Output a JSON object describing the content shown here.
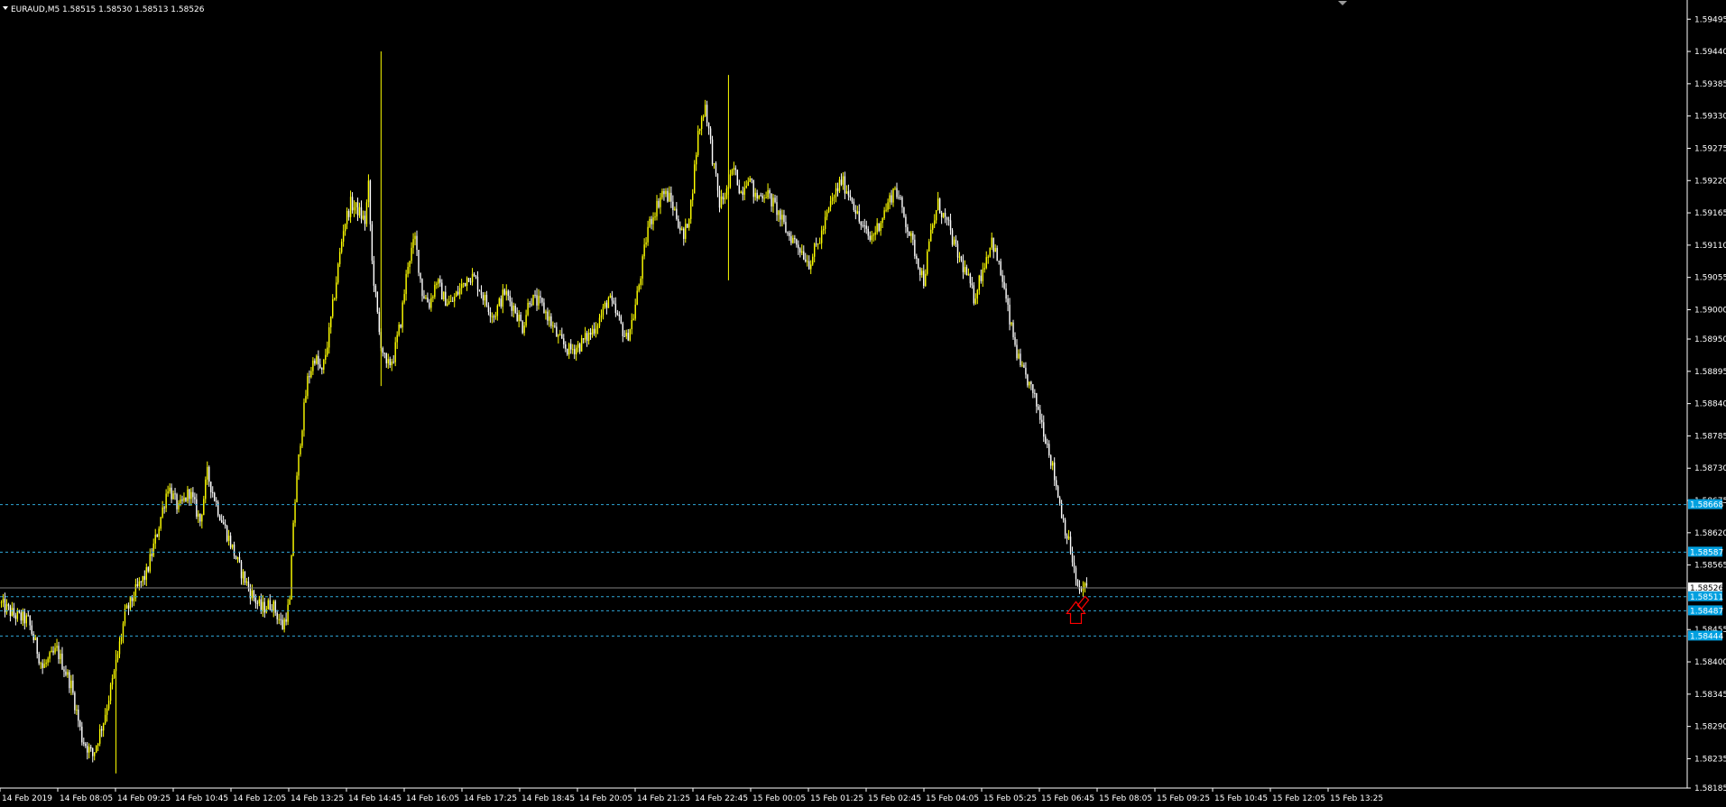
{
  "header": {
    "symbol_timeframe": "EURAUD,M5",
    "ohlc_text": "1.58515 1.58530 1.58513 1.58526"
  },
  "colors": {
    "background": "#000000",
    "bull": "#ffff00",
    "bear": "#ffffff",
    "axis": "#ffffff",
    "level_line": "#2fa7d8",
    "level_label_bg": "#00a0e0",
    "current_line": "#808080",
    "arrow": "#ff0000"
  },
  "chart_data": {
    "type": "candlestick",
    "title": "EURAUD,M5",
    "ylim": [
      1.58185,
      1.595
    ],
    "y_ticks": [
      1.59495,
      1.5944,
      1.59385,
      1.5933,
      1.59275,
      1.5922,
      1.59165,
      1.5911,
      1.59055,
      1.59,
      1.5895,
      1.58895,
      1.5884,
      1.58785,
      1.5873,
      1.58675,
      1.5862,
      1.58565,
      1.58455,
      1.584,
      1.58345,
      1.5829,
      1.58235,
      1.58185
    ],
    "y_tick_labels": [
      "1.59495",
      "1.59440",
      "1.59385",
      "1.59330",
      "1.59275",
      "1.59220",
      "1.59165",
      "1.59110",
      "1.59055",
      "1.59000",
      "1.58950",
      "1.58895",
      "1.58840",
      "1.58785",
      "1.58730",
      "1.58675",
      "1.58620",
      "1.58565",
      "1.58455",
      "1.58400",
      "1.58345",
      "1.58290",
      "1.58235",
      "1.58185"
    ],
    "time_labels": [
      "14 Feb 2019",
      "14 Feb 08:05",
      "14 Feb 09:25",
      "14 Feb 10:45",
      "14 Feb 12:05",
      "14 Feb 13:25",
      "14 Feb 14:45",
      "14 Feb 16:05",
      "14 Feb 17:25",
      "14 Feb 18:45",
      "14 Feb 20:05",
      "14 Feb 21:25",
      "14 Feb 22:45",
      "15 Feb 00:05",
      "15 Feb 01:25",
      "15 Feb 02:45",
      "15 Feb 04:05",
      "15 Feb 05:25",
      "15 Feb 06:45",
      "15 Feb 08:05",
      "15 Feb 09:25",
      "15 Feb 10:45",
      "15 Feb 12:05",
      "15 Feb 13:25"
    ],
    "price_path": [
      [
        0,
        1.585
      ],
      [
        8,
        1.5848
      ],
      [
        16,
        1.5847
      ],
      [
        24,
        1.5839
      ],
      [
        32,
        1.5842
      ],
      [
        40,
        1.5836
      ],
      [
        46,
        1.5827
      ],
      [
        52,
        1.5824
      ],
      [
        58,
        1.583
      ],
      [
        64,
        1.5838
      ],
      [
        70,
        1.5848
      ],
      [
        76,
        1.5852
      ],
      [
        82,
        1.5855
      ],
      [
        88,
        1.5862
      ],
      [
        94,
        1.587
      ],
      [
        100,
        1.5866
      ],
      [
        106,
        1.5869
      ],
      [
        112,
        1.5864
      ],
      [
        116,
        1.5872
      ],
      [
        122,
        1.5866
      ],
      [
        128,
        1.5861
      ],
      [
        134,
        1.5856
      ],
      [
        140,
        1.5852
      ],
      [
        146,
        1.5849
      ],
      [
        152,
        1.585
      ],
      [
        158,
        1.5846
      ],
      [
        162,
        1.585
      ],
      [
        164,
        1.5864
      ],
      [
        168,
        1.5878
      ],
      [
        172,
        1.5888
      ],
      [
        176,
        1.5892
      ],
      [
        180,
        1.5889
      ],
      [
        184,
        1.5896
      ],
      [
        188,
        1.5905
      ],
      [
        192,
        1.5914
      ],
      [
        196,
        1.5918
      ],
      [
        200,
        1.5917
      ],
      [
        204,
        1.5915
      ],
      [
        206,
        1.5921
      ],
      [
        208,
        1.5908
      ],
      [
        212,
        1.5896
      ],
      [
        216,
        1.589
      ],
      [
        220,
        1.5892
      ],
      [
        224,
        1.5898
      ],
      [
        228,
        1.5908
      ],
      [
        232,
        1.5912
      ],
      [
        236,
        1.5903
      ],
      [
        240,
        1.5901
      ],
      [
        244,
        1.5905
      ],
      [
        248,
        1.5902
      ],
      [
        252,
        1.5901
      ],
      [
        258,
        1.5904
      ],
      [
        262,
        1.5906
      ],
      [
        266,
        1.5905
      ],
      [
        272,
        1.5901
      ],
      [
        276,
        1.5899
      ],
      [
        282,
        1.5903
      ],
      [
        288,
        1.59
      ],
      [
        292,
        1.5897
      ],
      [
        296,
        1.5902
      ],
      [
        302,
        1.5901
      ],
      [
        306,
        1.5899
      ],
      [
        312,
        1.5895
      ],
      [
        318,
        1.5893
      ],
      [
        324,
        1.5894
      ],
      [
        330,
        1.5896
      ],
      [
        336,
        1.5899
      ],
      [
        340,
        1.5902
      ],
      [
        346,
        1.5898
      ],
      [
        350,
        1.5895
      ],
      [
        354,
        1.5899
      ],
      [
        358,
        1.5906
      ],
      [
        362,
        1.5914
      ],
      [
        366,
        1.5917
      ],
      [
        370,
        1.592
      ],
      [
        374,
        1.5919
      ],
      [
        378,
        1.5916
      ],
      [
        382,
        1.5912
      ],
      [
        386,
        1.5918
      ],
      [
        390,
        1.593
      ],
      [
        394,
        1.5935
      ],
      [
        398,
        1.5926
      ],
      [
        402,
        1.5918
      ],
      [
        406,
        1.592
      ],
      [
        410,
        1.5924
      ],
      [
        414,
        1.592
      ],
      [
        418,
        1.5923
      ],
      [
        422,
        1.5919
      ],
      [
        428,
        1.592
      ],
      [
        434,
        1.5917
      ],
      [
        440,
        1.5913
      ],
      [
        446,
        1.5911
      ],
      [
        452,
        1.5908
      ],
      [
        458,
        1.5912
      ],
      [
        464,
        1.5918
      ],
      [
        470,
        1.5922
      ],
      [
        476,
        1.5919
      ],
      [
        480,
        1.5915
      ],
      [
        486,
        1.5912
      ],
      [
        490,
        1.5914
      ],
      [
        496,
        1.5918
      ],
      [
        500,
        1.5921
      ],
      [
        506,
        1.5915
      ],
      [
        510,
        1.5911
      ],
      [
        516,
        1.5905
      ],
      [
        520,
        1.5913
      ],
      [
        524,
        1.5918
      ],
      [
        530,
        1.5914
      ],
      [
        534,
        1.591
      ],
      [
        540,
        1.5906
      ],
      [
        544,
        1.5902
      ],
      [
        550,
        1.5908
      ],
      [
        554,
        1.5912
      ],
      [
        560,
        1.5905
      ],
      [
        564,
        1.5898
      ],
      [
        570,
        1.589
      ],
      [
        574,
        1.5888
      ],
      [
        580,
        1.5883
      ],
      [
        586,
        1.5876
      ],
      [
        590,
        1.587
      ],
      [
        594,
        1.5864
      ],
      [
        598,
        1.5859
      ],
      [
        602,
        1.5852
      ],
      [
        606,
        1.58526
      ]
    ],
    "levels": [
      {
        "price": 1.58668,
        "label": "1.58668",
        "style": "dashed"
      },
      {
        "price": 1.58587,
        "label": "1.58587",
        "style": "dashed"
      },
      {
        "price": 1.58526,
        "label": "1.58526",
        "style": "solid"
      },
      {
        "price": 1.58511,
        "label": "1.58511",
        "style": "dashed"
      },
      {
        "price": 1.58487,
        "label": "1.58487",
        "style": "dashed"
      },
      {
        "price": 1.58444,
        "label": "1.58444",
        "style": "dashed"
      }
    ],
    "current_price": 1.58526
  }
}
